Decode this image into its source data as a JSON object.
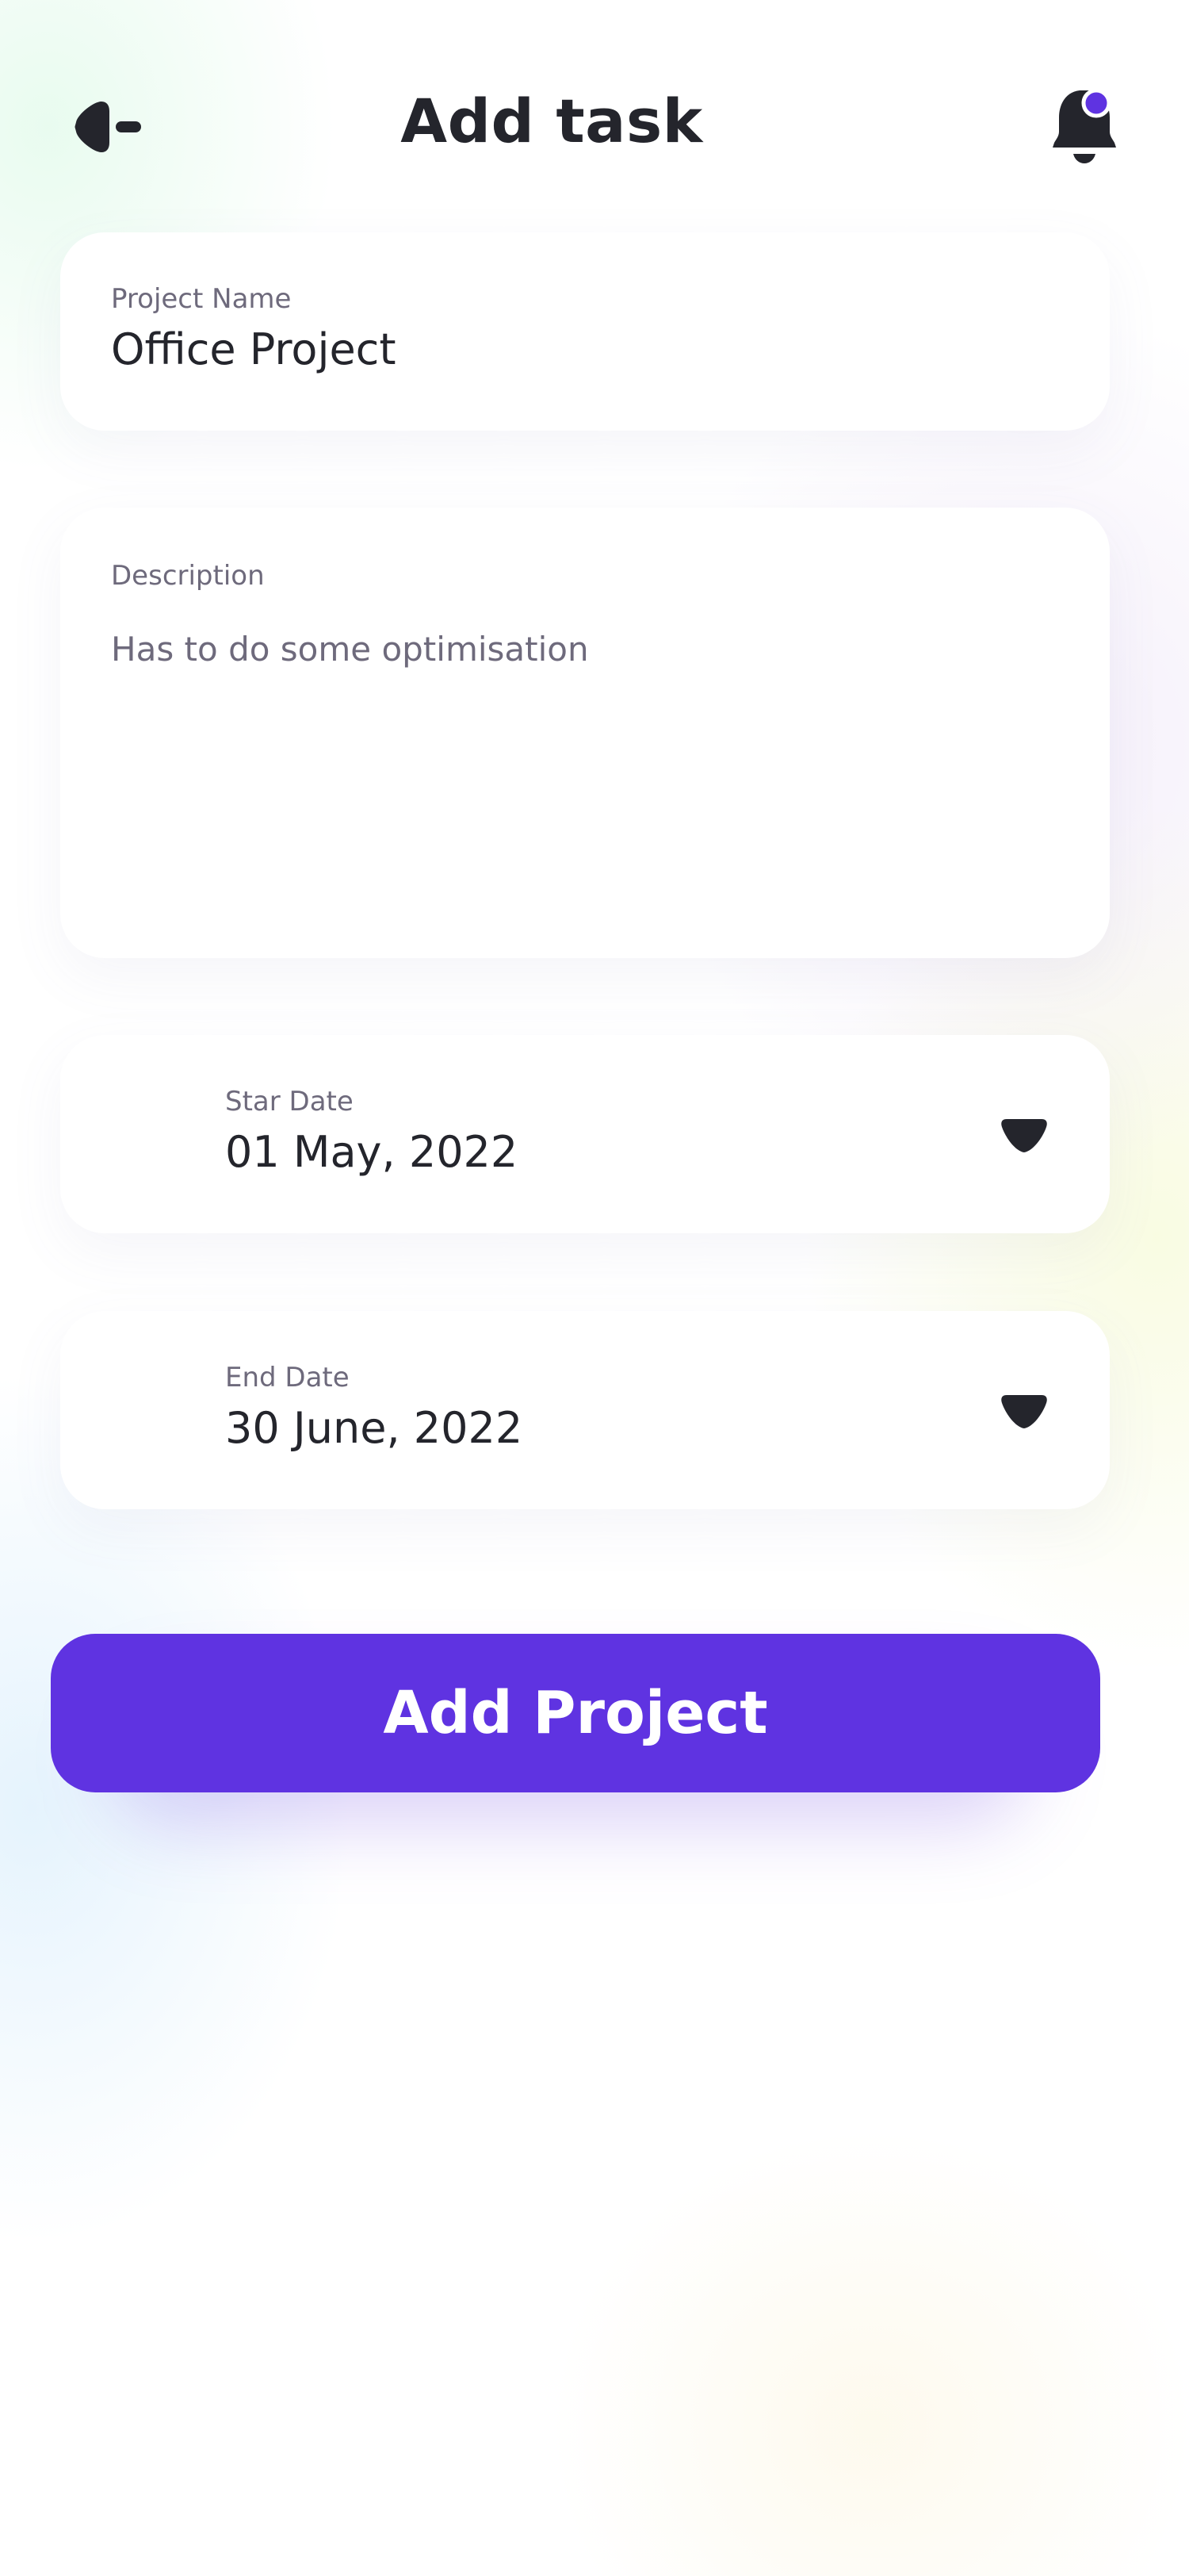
{
  "header": {
    "title": "Add task",
    "back_icon": "back-arrow-icon",
    "notification_icon": "bell-icon",
    "notification_dot_color": "#5F33E1"
  },
  "project_name": {
    "label": "Project Name",
    "value": "Office Project"
  },
  "description": {
    "label": "Description",
    "value": "Has to do some optimisation"
  },
  "start_date": {
    "label": "Star Date",
    "value": "01 May, 2022",
    "icon": "caret-down-icon"
  },
  "end_date": {
    "label": "End Date",
    "value": "30 June, 2022",
    "icon": "caret-down-icon"
  },
  "actions": {
    "add_project_label": "Add Project"
  },
  "colors": {
    "accent": "#5F33E1",
    "text_dark": "#24252C",
    "text_muted": "#6E6A7C",
    "card_bg": "#FFFFFF"
  }
}
